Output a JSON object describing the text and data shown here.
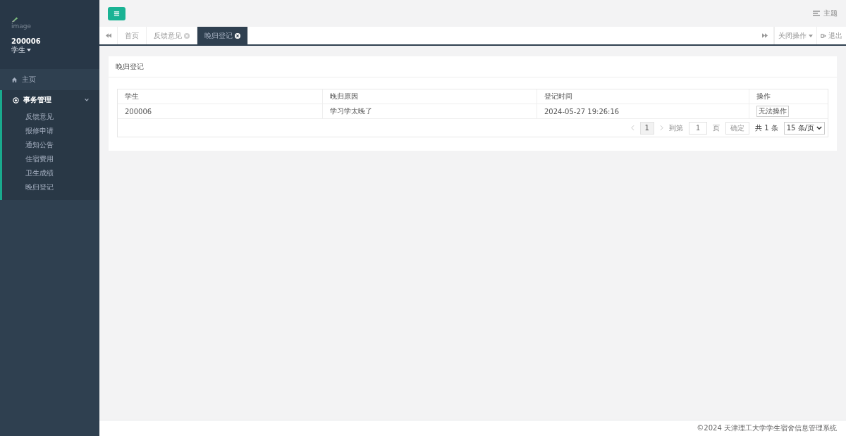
{
  "sidebar": {
    "logo_alt": "image",
    "user": {
      "name": "200006",
      "role": "学生"
    },
    "items": [
      {
        "kind": "link",
        "label": "主页"
      },
      {
        "kind": "group",
        "label": "事务管理",
        "expanded": true,
        "children": [
          {
            "label": "反馈意见"
          },
          {
            "label": "报修申请"
          },
          {
            "label": "通知公告"
          },
          {
            "label": "住宿费用"
          },
          {
            "label": "卫生成绩"
          },
          {
            "label": "晚归登记"
          }
        ]
      }
    ]
  },
  "topbar": {
    "theme_label": "主题"
  },
  "tabs": [
    {
      "label": "首页",
      "selected": false,
      "closable": false
    },
    {
      "label": "反馈意见",
      "selected": false,
      "closable": true
    },
    {
      "label": "晚归登记",
      "selected": true,
      "closable": true
    }
  ],
  "tab_actions": {
    "close_menu": "关闭操作",
    "logout": "退出"
  },
  "panel": {
    "title": "晚归登记",
    "table": {
      "columns": [
        "学生",
        "晚归原因",
        "登记时间",
        "操作"
      ],
      "rows": [
        {
          "student": "200006",
          "reason": "学习学太晚了",
          "time": "2024-05-27 19:26:16",
          "action": "无法操作"
        }
      ]
    },
    "pagination": {
      "current": "1",
      "goto_label": "到第",
      "goto_value": "1",
      "page_label": "页",
      "confirm": "确定",
      "total": "共 1 条",
      "page_size": "15 条/页"
    }
  },
  "footer": "©2024 天津理工大学学生宿舍信息管理系统"
}
